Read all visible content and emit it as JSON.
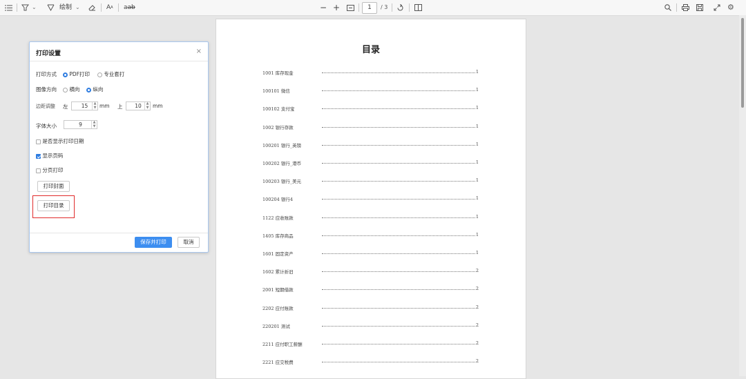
{
  "toolbar": {
    "draw_label": "绘制",
    "page_current": "1",
    "page_total": "/ 3"
  },
  "document": {
    "title": "目录",
    "toc": [
      {
        "name": "1001 库存现金",
        "page": "1"
      },
      {
        "name": "100101 微信",
        "page": "1"
      },
      {
        "name": "100102 支付宝",
        "page": "1"
      },
      {
        "name": "1002 银行存款",
        "page": "1"
      },
      {
        "name": "100201 银行_英镑",
        "page": "1"
      },
      {
        "name": "100202 银行_港币",
        "page": "1"
      },
      {
        "name": "100203 银行_美元",
        "page": "1"
      },
      {
        "name": "100204 银行4",
        "page": "1"
      },
      {
        "name": "1122 应收账款",
        "page": "1"
      },
      {
        "name": "1405 库存商品",
        "page": "1"
      },
      {
        "name": "1601 固定资产",
        "page": "1"
      },
      {
        "name": "1602 累计折旧",
        "page": "2"
      },
      {
        "name": "2001 短期借款",
        "page": "2"
      },
      {
        "name": "2202 应付账款",
        "page": "2"
      },
      {
        "name": "220201 测试",
        "page": "2"
      },
      {
        "name": "2211 应付职工薪酬",
        "page": "2"
      },
      {
        "name": "2221 应交税费",
        "page": "2"
      }
    ]
  },
  "dialog": {
    "title": "打印设置",
    "close": "×",
    "print_mode_label": "打印方式",
    "print_mode_options": [
      "PDF打印",
      "专业套打"
    ],
    "orientation_label": "图像方向",
    "orientation_options": [
      "横向",
      "纵向"
    ],
    "margin_label": "边距调整",
    "margin_left_label": "左",
    "margin_left_value": "15",
    "margin_top_label": "上",
    "margin_top_value": "10",
    "unit": "mm",
    "font_size_label": "字体大小",
    "font_size_value": "9",
    "show_print_date": "是否显示打印日期",
    "show_page_number": "显示页码",
    "page_break_print": "分页打印",
    "print_cover_button": "打印封面",
    "print_toc_button": "打印目录",
    "save_print_button": "保存并打印",
    "cancel_button": "取消"
  },
  "colors": {
    "accent": "#3d8ef0",
    "highlight": "#e02a2a"
  }
}
